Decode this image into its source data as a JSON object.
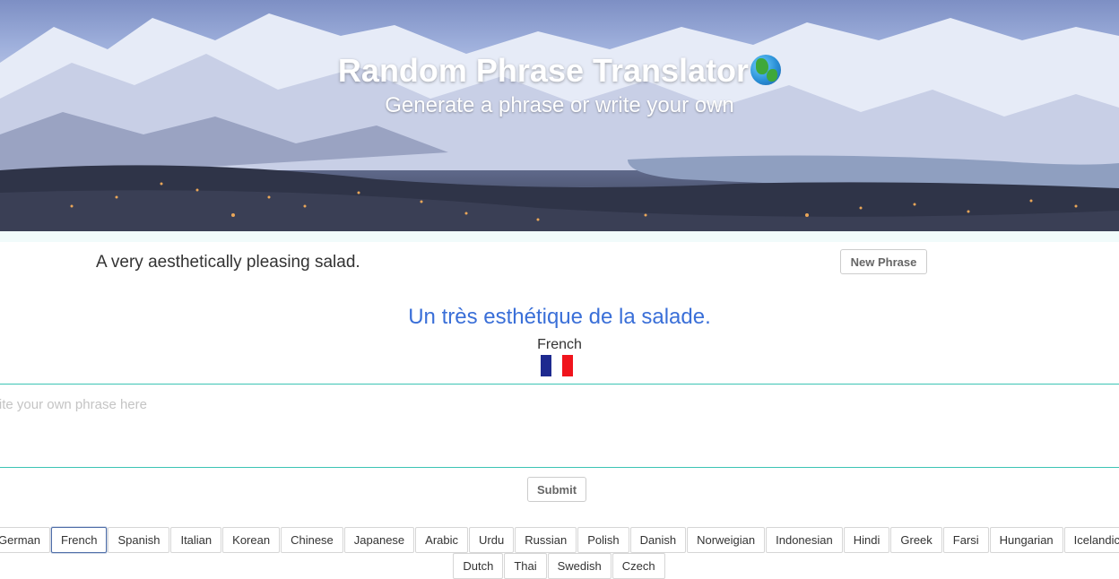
{
  "header": {
    "title": "Random Phrase Translator",
    "title_icon": "globe-icon",
    "subtitle": "Generate a phrase or write your own"
  },
  "phrase": {
    "text": "A very aesthetically pleasing salad.",
    "new_phrase_label": "New Phrase"
  },
  "translation": {
    "text": "Un très esthétique de la salade.",
    "language": "French",
    "flag_icon": "france-flag-icon",
    "flag_colors": [
      "#1e2a8f",
      "#ffffff",
      "#f0141c"
    ]
  },
  "input": {
    "value": "",
    "placeholder": "Write your own phrase here"
  },
  "submit_label": "Submit",
  "languages": {
    "selected": "French",
    "row1": [
      "German",
      "French",
      "Spanish",
      "Italian",
      "Korean",
      "Chinese",
      "Japanese",
      "Arabic",
      "Urdu",
      "Russian",
      "Polish",
      "Danish",
      "Norweigian",
      "Indonesian",
      "Hindi",
      "Greek",
      "Farsi",
      "Hungarian",
      "Icelandic"
    ],
    "row2": [
      "Dutch",
      "Thai",
      "Swedish",
      "Czech"
    ]
  },
  "colors": {
    "translation_text": "#3a6fd8",
    "input_border": "#3cc4b4",
    "active_button_border": "#4f6ea8"
  }
}
